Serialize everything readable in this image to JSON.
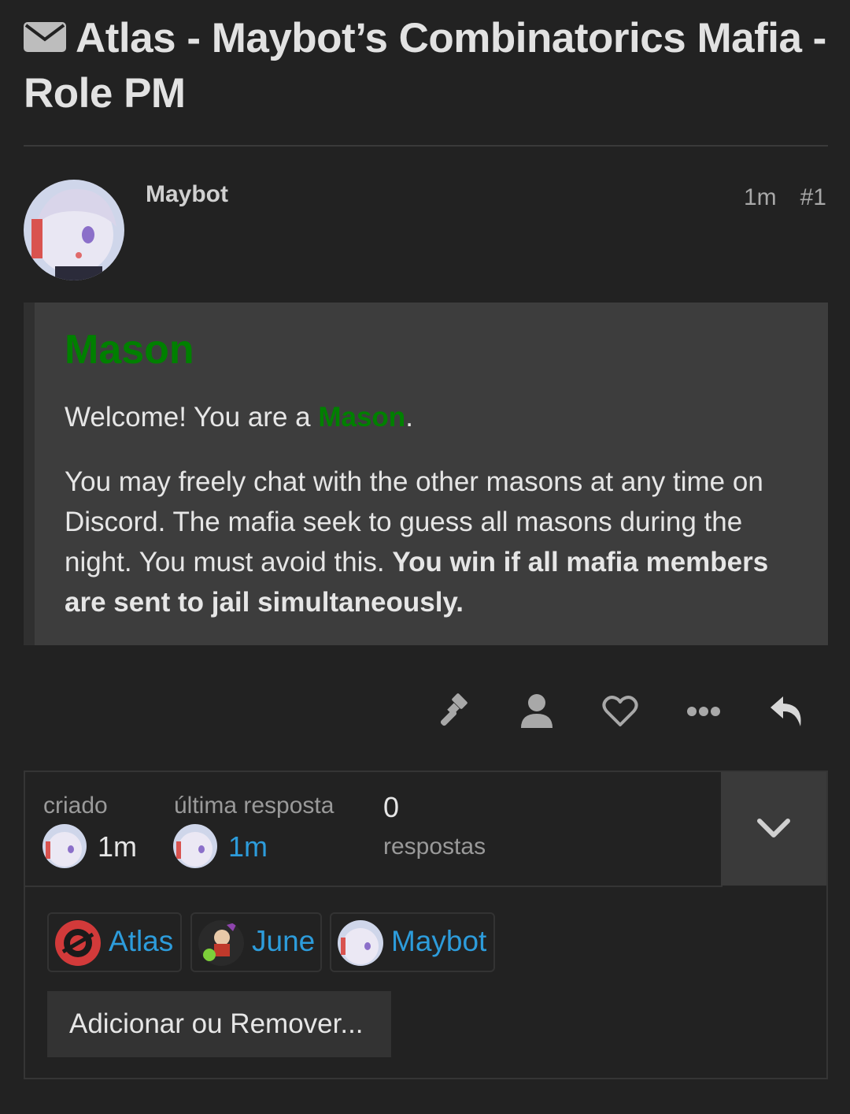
{
  "topic": {
    "title": "Atlas - Maybot’s Combinatorics Mafia - Role PM",
    "icon": "envelope-icon"
  },
  "post": {
    "author": "Maybot",
    "age": "1m",
    "number": "#1",
    "role_heading": "Mason",
    "welcome_prefix": "Welcome! You are a ",
    "welcome_role": "Mason",
    "welcome_suffix": ".",
    "body_text": "You may freely chat with the other masons at any time on Discord. The mafia seek to guess all masons during the night. You must avoid this. ",
    "body_bold": "You win if all mafia members are sent to jail simultaneously.",
    "role_color": "#008000"
  },
  "actions": {
    "items": [
      "gavel-icon",
      "user-icon",
      "heart-icon",
      "more-icon",
      "reply-icon"
    ]
  },
  "summary": {
    "created_label": "criado",
    "created_value": "1m",
    "last_reply_label": "última resposta",
    "last_reply_value": "1m",
    "replies_count": "0",
    "replies_label": "respostas"
  },
  "participants": [
    {
      "name": "Atlas"
    },
    {
      "name": "June"
    },
    {
      "name": "Maybot"
    }
  ],
  "add_remove_label": "Adicionar ou Remover...",
  "colors": {
    "background": "#222222",
    "quote_bg": "#3d3d3d",
    "link": "#2d9cdb"
  }
}
